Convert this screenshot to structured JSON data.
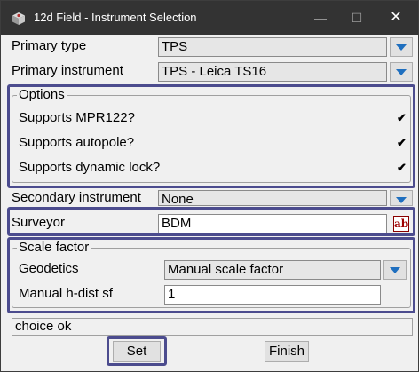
{
  "window": {
    "title": "12d Field - Instrument Selection",
    "minimize": "—",
    "maximize": "☐",
    "close": "✕"
  },
  "primary_type": {
    "label": "Primary type",
    "value": "TPS"
  },
  "primary_instrument": {
    "label": "Primary instrument",
    "value": "TPS - Leica TS16"
  },
  "options": {
    "title": "Options",
    "items": [
      {
        "label": "Supports MPR122?",
        "checked": true,
        "mark": "✔"
      },
      {
        "label": "Supports autopole?",
        "checked": true,
        "mark": "✔"
      },
      {
        "label": "Supports dynamic lock?",
        "checked": true,
        "mark": "✔"
      }
    ]
  },
  "secondary_instrument": {
    "label": "Secondary instrument",
    "value": "None"
  },
  "surveyor": {
    "label": "Surveyor",
    "value": "BDM",
    "picker": "ab"
  },
  "scale_factor": {
    "title": "Scale factor",
    "geodetics_label": "Geodetics",
    "geodetics_value": "Manual scale factor",
    "manual_label": "Manual h-dist sf",
    "manual_value": "1"
  },
  "status": {
    "text": "choice ok"
  },
  "buttons": {
    "set": "Set",
    "finish": "Finish"
  },
  "colors": {
    "titlebar": "#333333",
    "highlight": "#4c4c8e",
    "dropdown_arrow": "#1f6fbf"
  }
}
